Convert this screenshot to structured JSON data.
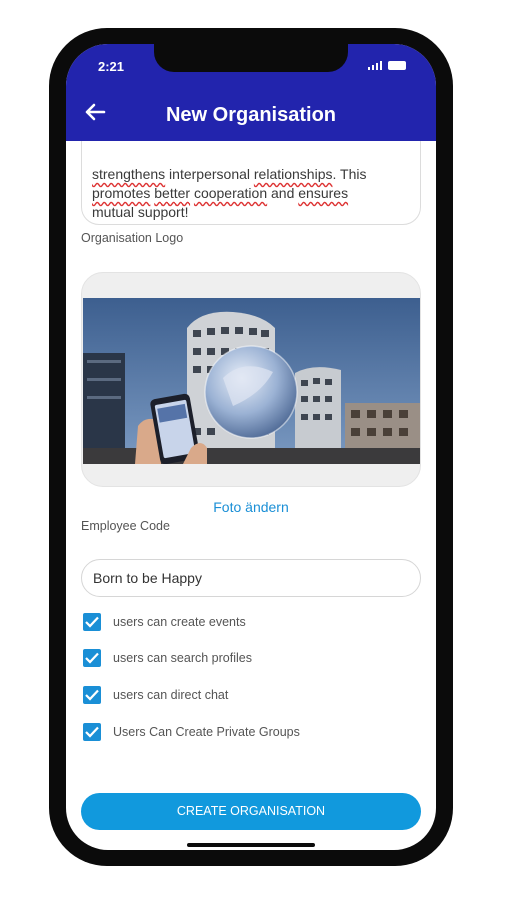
{
  "status_bar": {
    "time": "2:21"
  },
  "header": {
    "title": "New Organisation",
    "back_icon": "arrow-left-icon"
  },
  "description": {
    "lines": [
      [
        "strengthens",
        " interpersonal ",
        "relationships",
        ". This"
      ],
      [
        "promotes",
        " ",
        "better",
        " ",
        "cooperation",
        " and ",
        "ensures"
      ],
      [
        "mutual support!"
      ]
    ]
  },
  "logo_section": {
    "label": "Organisation Logo",
    "change_photo_label": "Foto ändern"
  },
  "employee_code": {
    "label": "Employee Code",
    "value": "Born to be Happy"
  },
  "permissions": [
    {
      "label": "users can create events",
      "checked": true
    },
    {
      "label": "users can search profiles",
      "checked": true
    },
    {
      "label": "users can direct chat",
      "checked": true
    },
    {
      "label": "Users Can Create Private Groups",
      "checked": true
    }
  ],
  "create_button": {
    "label": "CREATE ORGANISATION"
  },
  "colors": {
    "appbar": "#2224ad",
    "accent": "#1a8fd6",
    "button": "#1199dd"
  }
}
